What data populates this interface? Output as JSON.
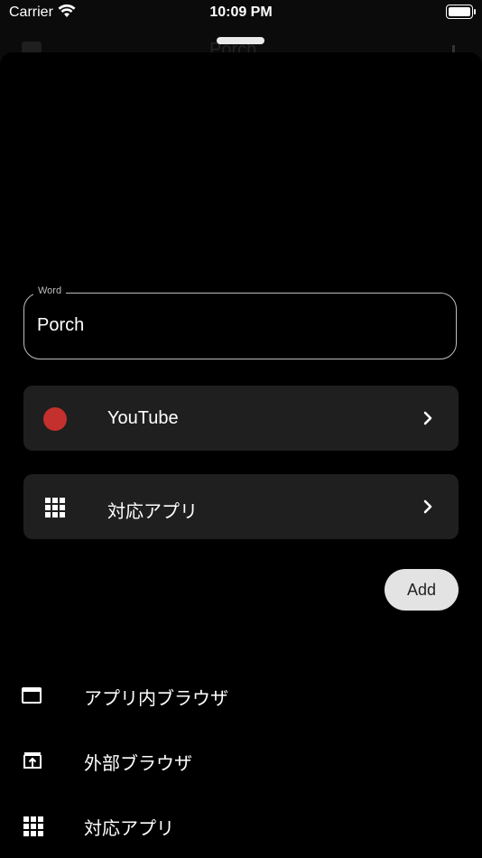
{
  "status_bar": {
    "carrier": "Carrier",
    "time": "10:09 PM"
  },
  "background_page": {
    "title": "Porch"
  },
  "sheet": {
    "word_field": {
      "label": "Word",
      "value": "Porch"
    },
    "rows": [
      {
        "label": "YouTube",
        "icon": "record-dot-icon",
        "icon_color": "#c3302d"
      },
      {
        "label": "対応アプリ",
        "icon": "grid-icon"
      }
    ],
    "add_label": "Add"
  },
  "bottom_menu": [
    {
      "label": "アプリ内ブラウザ",
      "icon": "in-app-browser-icon"
    },
    {
      "label": "外部ブラウザ",
      "icon": "external-browser-icon"
    },
    {
      "label": "対応アプリ",
      "icon": "grid-icon"
    }
  ],
  "colors": {
    "background": "#000000",
    "row_bg": "#1f1f1f",
    "accent_red": "#c3302d",
    "button_bg": "#e3e3e3"
  }
}
